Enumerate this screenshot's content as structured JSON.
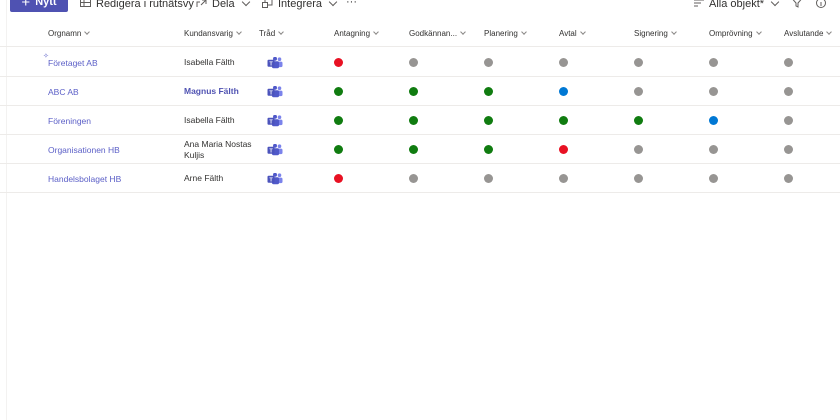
{
  "toolbar": {
    "new_label": "Nytt",
    "grid_edit_label": "Redigera i rutnätsvy",
    "share_label": "Dela",
    "integrate_label": "Integrera",
    "more_label": "···",
    "view_label": "Alla objekt*"
  },
  "columns": [
    {
      "key": "org",
      "label": "Orgnamn"
    },
    {
      "key": "kund",
      "label": "Kundansvarig"
    },
    {
      "key": "trad",
      "label": "Tråd"
    },
    {
      "key": "antagning",
      "label": "Antagning"
    },
    {
      "key": "godkannande",
      "label": "Godkännan..."
    },
    {
      "key": "planering",
      "label": "Planering"
    },
    {
      "key": "avtal",
      "label": "Avtal"
    },
    {
      "key": "signering",
      "label": "Signering"
    },
    {
      "key": "omprovning",
      "label": "Omprövning"
    },
    {
      "key": "avslutande",
      "label": "Avslutande"
    }
  ],
  "colors": {
    "red": "#e81123",
    "gray": "#979593",
    "green": "#107c10",
    "blue": "#0078d4",
    "accent": "#5b5fc7"
  },
  "rows": [
    {
      "org": "Företaget AB",
      "kund": "Isabella Fälth",
      "kund_bold": false,
      "status": [
        "red",
        "gray",
        "gray",
        "gray",
        "gray",
        "gray",
        "gray"
      ]
    },
    {
      "org": "ABC AB",
      "kund": "Magnus Fälth",
      "kund_bold": true,
      "status": [
        "green",
        "green",
        "green",
        "blue",
        "gray",
        "gray",
        "gray"
      ]
    },
    {
      "org": "Föreningen",
      "kund": "Isabella Fälth",
      "kund_bold": false,
      "status": [
        "green",
        "green",
        "green",
        "green",
        "green",
        "blue",
        "gray"
      ]
    },
    {
      "org": "Organisationen HB",
      "kund": "Ana Maria Nostas Kuljis",
      "kund_bold": false,
      "status": [
        "green",
        "green",
        "green",
        "red",
        "gray",
        "gray",
        "gray"
      ]
    },
    {
      "org": "Handelsbolaget HB",
      "kund": "Arne Fälth",
      "kund_bold": false,
      "status": [
        "red",
        "gray",
        "gray",
        "gray",
        "gray",
        "gray",
        "gray"
      ]
    }
  ]
}
